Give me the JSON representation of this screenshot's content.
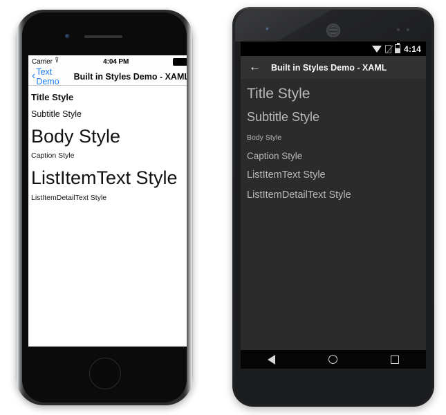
{
  "page": {
    "background": "#ffffff",
    "description": "Side-by-side iOS and Android device mockups showing Built in Styles Demo - XAML"
  },
  "ios": {
    "device": "iphone",
    "status_bar": {
      "carrier": "Carrier",
      "wifi_icon": "wifi-icon",
      "time": "4:04 PM",
      "battery_icon": "battery-full-icon"
    },
    "nav_bar": {
      "back_chevron": "‹",
      "back_label": "Text Demo",
      "title": "Built in Styles Demo - XAML",
      "back_color": "#1a7cf7"
    },
    "content": {
      "labels": [
        {
          "text": "Title Style",
          "style": "title"
        },
        {
          "text": "Subtitle Style",
          "style": "subtitle"
        },
        {
          "text": "Body Style",
          "style": "body"
        },
        {
          "text": "Caption Style",
          "style": "caption"
        },
        {
          "text": "ListItemText Style",
          "style": "listitemtext"
        },
        {
          "text": "ListItemDetailText Style",
          "style": "listitemdetailtext"
        }
      ],
      "background": "#ffffff",
      "text_color": "#111111"
    }
  },
  "android": {
    "device": "android-phone",
    "status_bar": {
      "wifi_icon": "wifi-icon",
      "sim_icon": "no-sim-icon",
      "battery_icon": "battery-icon",
      "time": "4:14",
      "background": "#000000"
    },
    "action_bar": {
      "back_arrow": "←",
      "title": "Built in Styles Demo - XAML",
      "background": "#323232",
      "text_color": "#fafafa"
    },
    "content": {
      "labels": [
        {
          "text": "Title Style",
          "style": "title"
        },
        {
          "text": "Subtitle Style",
          "style": "subtitle"
        },
        {
          "text": "Body Style",
          "style": "body"
        },
        {
          "text": "Caption Style",
          "style": "caption"
        },
        {
          "text": "ListItemText Style",
          "style": "listitemtext"
        },
        {
          "text": "ListItemDetailText Style",
          "style": "listitemdetailtext"
        }
      ],
      "background": "#2b2b2b",
      "text_color": "#b9b9b9"
    },
    "nav_bar": {
      "back_icon": "triangle-back-icon",
      "home_icon": "circle-home-icon",
      "recents_icon": "square-recents-icon",
      "background": "#050505"
    }
  }
}
